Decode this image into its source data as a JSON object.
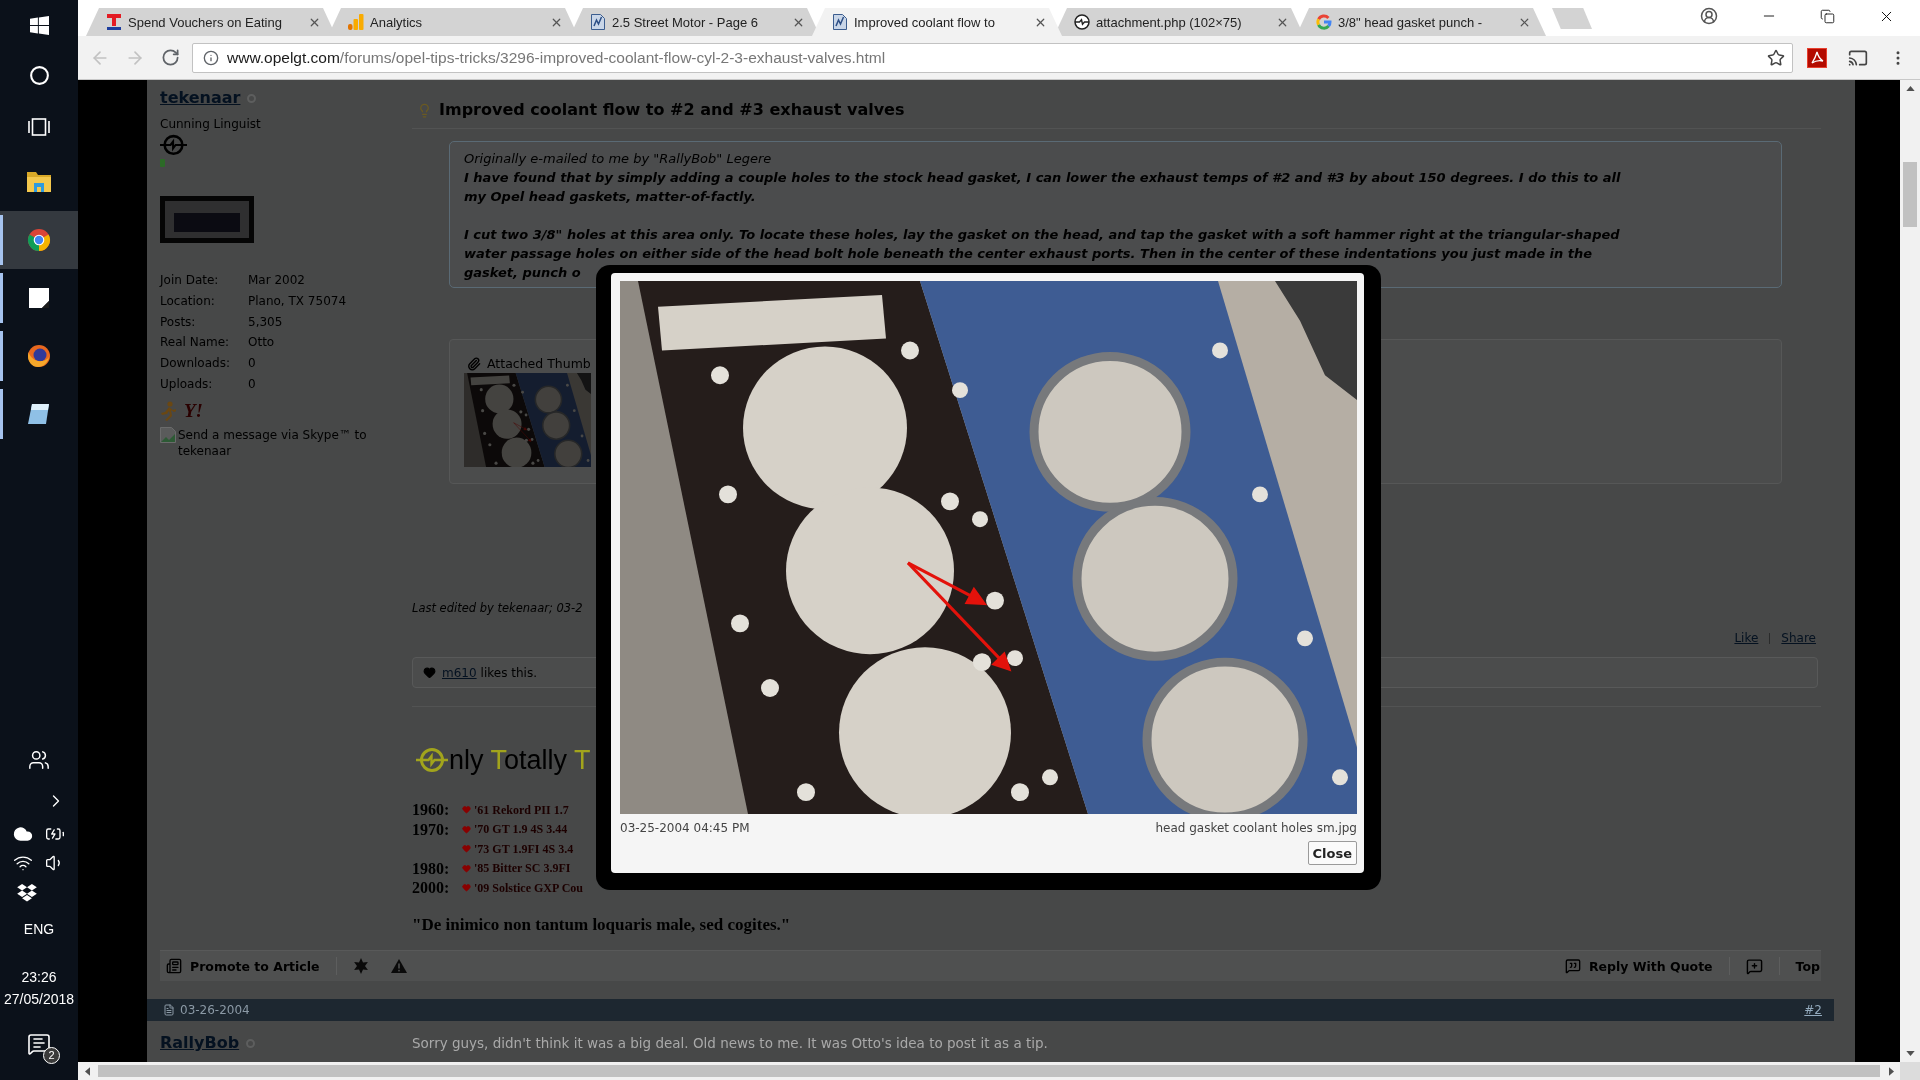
{
  "taskbar": {
    "apps": [
      {
        "kind": "start",
        "running": false,
        "selected": false
      },
      {
        "kind": "search",
        "running": false,
        "selected": false
      },
      {
        "kind": "tasks",
        "running": false,
        "selected": false
      },
      {
        "kind": "folder",
        "running": false,
        "selected": false
      },
      {
        "kind": "globe",
        "running": true,
        "selected": true
      },
      {
        "kind": "note",
        "running": true,
        "selected": false
      },
      {
        "kind": "fox",
        "running": true,
        "selected": false
      },
      {
        "kind": "tablet",
        "running": true,
        "selected": false
      }
    ],
    "tray": {
      "language": "ENG",
      "time": "23:26",
      "date": "27/05/2018",
      "notification_count": "2"
    }
  },
  "browser": {
    "tabs": [
      {
        "title": "Spend Vouchers on Eating",
        "kind": "letter",
        "selected": false
      },
      {
        "title": "Analytics",
        "kind": "bars",
        "selected": false
      },
      {
        "title": "2.5 Street Motor - Page 6",
        "kind": "page",
        "selected": false
      },
      {
        "title": "Improved coolant flow to",
        "kind": "page",
        "selected": true
      },
      {
        "title": "attachment.php (102×75)",
        "kind": "ring",
        "selected": false
      },
      {
        "title": "3/8\" head gasket punch -",
        "kind": "g",
        "selected": false
      }
    ],
    "back_disabled": true,
    "forward_disabled": true,
    "url": {
      "host": "www.opelgt.com",
      "path": "/forums/opel-tips-tricks/3296-improved-coolant-flow-cyl-2-3-exhaust-valves.html"
    },
    "bookmarked": false
  },
  "thread": {
    "post": {
      "author": {
        "name": "tekenaar",
        "online": false,
        "rank": "Cunning Linguist",
        "details": [
          {
            "label": "Join Date:",
            "value": "Mar 2002"
          },
          {
            "label": "Location:",
            "value": "Plano, TX 75074"
          },
          {
            "label": "Posts:",
            "value": "5,305"
          },
          {
            "label": "Real Name:",
            "value": "Otto"
          },
          {
            "label": "Downloads:",
            "value": "0"
          },
          {
            "label": "Uploads:",
            "value": "0"
          }
        ],
        "messengers": [
          {
            "kind": "figure"
          },
          {
            "kind": "glyph",
            "text": "Y!"
          }
        ],
        "skype_alt": "Send a message via Skype™ to tekenaar"
      },
      "title": "Improved coolant flow to #2 and #3 exhaust valves",
      "quote": {
        "attribution": "Originally e-mailed to me by \"RallyBob\" Legere",
        "paragraphs": [
          [
            "I have found that by simply adding a couple holes to the stock head gasket, I can lower the exhaust temps of #2 and #3 by about 150 degrees. I do this to all",
            "my Opel head gaskets, matter-of-factly."
          ],
          [
            "I cut two 3/8\" holes at this area only. To locate these holes, lay the gasket on the head, and tap the gasket with a soft hammer right at the triangular-shaped",
            "water passage holes on either side of the head bolt hole beneath the center exhaust ports. Then in the center of these indentations you just made in the",
            "gasket, punch o"
          ]
        ]
      },
      "attachments": {
        "heading": "Attached Thumb"
      },
      "last_edited": "Last edited by tekenaar; 03-2",
      "links": [
        "Like",
        "Share"
      ],
      "likes": {
        "user": "m610",
        "text": "likes this."
      },
      "signature": {
        "banner": [
          {
            "text": "nly ",
            "highlight": false
          },
          {
            "text": "T",
            "highlight": true
          },
          {
            "text": "otally ",
            "highlight": false
          },
          {
            "text": "T",
            "highlight": true
          }
        ],
        "cars": [
          {
            "year": "1960:",
            "model": "'61 Rekord PII 1.7"
          },
          {
            "year": "1970:",
            "model": "'70 GT 1.9 4S 3.44"
          },
          {
            "model": "'73 GT 1.9FI 4S 3.4"
          },
          {
            "year": "1980:",
            "model": "'85 Bitter SC 3.9FI"
          },
          {
            "year": "2000:",
            "model": "'09 Solstice GXP Cou"
          }
        ],
        "motto": "\"De inimico non tantum loquaris male, sed cogites.\""
      },
      "footer": {
        "promote": "Promote to Article",
        "reply": "Reply With Quote",
        "top": "Top"
      }
    },
    "next_post": {
      "date": "03-26-2004",
      "number": "#2",
      "author": "RallyBob",
      "online": false,
      "text": "Sorry guys, didn't think it was a big deal. Old news to me. It was Otto's idea to post it as a tip."
    }
  },
  "lightbox": {
    "date": "03-25-2004 04:45 PM",
    "filename": "head gasket coolant holes sm.jpg",
    "close_label": "Close"
  }
}
